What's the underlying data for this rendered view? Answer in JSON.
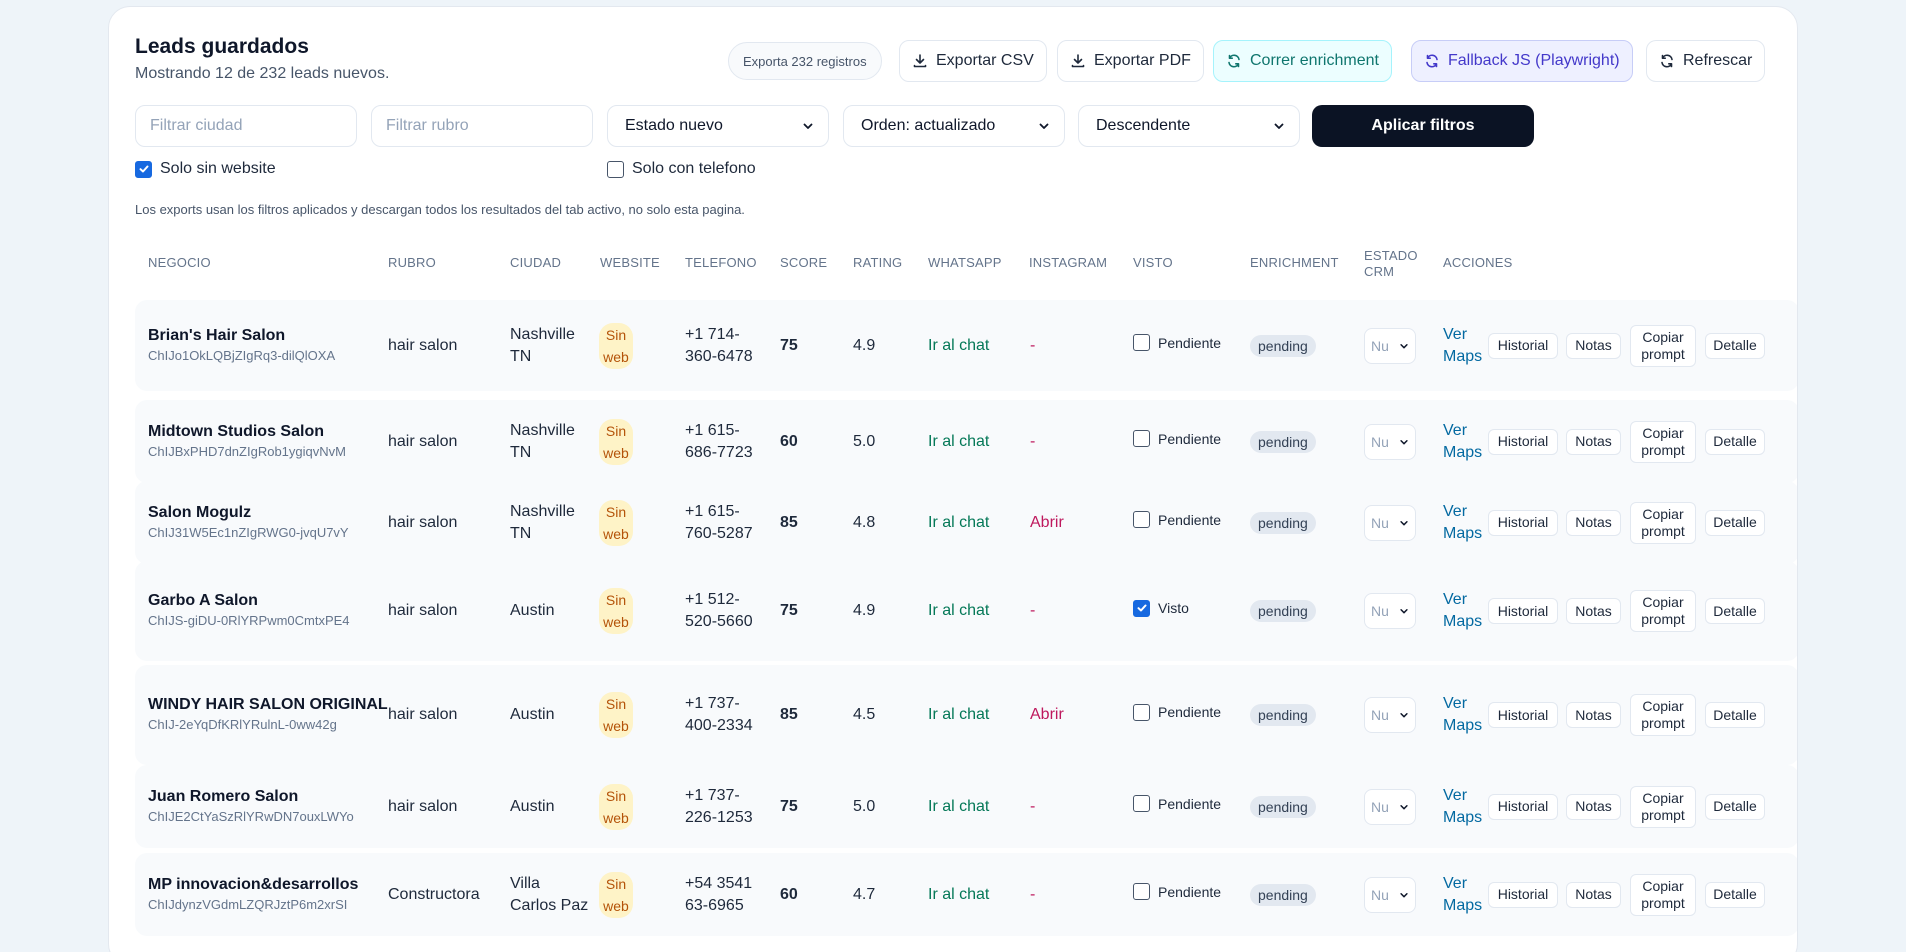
{
  "header": {
    "title": "Leads guardados",
    "subtitle": "Mostrando 12 de 232 leads nuevos."
  },
  "toolbar": {
    "export_count": "Exporta 232 registros",
    "export_csv": "Exportar CSV",
    "export_pdf": "Exportar PDF",
    "run_enrichment": "Correr enrichment",
    "fallback_js": "Fallback JS (Playwright)",
    "refresh": "Refrescar"
  },
  "filters": {
    "city_placeholder": "Filtrar ciudad",
    "category_placeholder": "Filtrar rubro",
    "state_value": "Estado nuevo",
    "order_value": "Orden: actualizado",
    "direction_value": "Descendente",
    "apply_label": "Aplicar filtros",
    "only_no_website_label": "Solo sin website",
    "only_no_website_checked": true,
    "only_with_phone_label": "Solo con telefono",
    "only_with_phone_checked": false,
    "note": "Los exports usan los filtros aplicados y descargan todos los resultados del tab activo, no solo esta pagina."
  },
  "table": {
    "columns": {
      "negocio": "NEGOCIO",
      "rubro": "RUBRO",
      "ciudad": "CIUDAD",
      "website": "WEBSITE",
      "telefono": "TELEFONO",
      "score": "SCORE",
      "rating": "RATING",
      "whatsapp": "WHATSAPP",
      "instagram": "INSTAGRAM",
      "visto": "VISTO",
      "enrichment": "ENRICHMENT",
      "estado_crm": "ESTADO CRM",
      "acciones": "ACCIONES"
    },
    "action_labels": {
      "maps": "Ver Maps",
      "historial": "Historial",
      "notas": "Notas",
      "copiar": "Copiar prompt",
      "detalle": "Detalle"
    },
    "rows": [
      {
        "name": "Brian's Hair Salon",
        "id": "ChIJo1OkLQBjZIgRq3-dilQlOXA",
        "rubro": "hair salon",
        "city": "Nashville TN",
        "website": "Sin web",
        "phone": "+1 714-360-6478",
        "score": "75",
        "rating": "4.9",
        "whatsapp": "Ir al chat",
        "instagram": "-",
        "visto": "Pendiente",
        "visto_checked": false,
        "enrichment": "pending",
        "crm": "Nu"
      },
      {
        "name": "Midtown Studios Salon",
        "id": "ChIJBxPHD7dnZIgRob1ygiqvNvM",
        "rubro": "hair salon",
        "city": "Nashville TN",
        "website": "Sin web",
        "phone": "+1 615-686-7723",
        "score": "60",
        "rating": "5.0",
        "whatsapp": "Ir al chat",
        "instagram": "-",
        "visto": "Pendiente",
        "visto_checked": false,
        "enrichment": "pending",
        "crm": "Nu"
      },
      {
        "name": "Salon Mogulz",
        "id": "ChIJ31W5Ec1nZIgRWG0-jvqU7vY",
        "rubro": "hair salon",
        "city": "Nashville TN",
        "website": "Sin web",
        "phone": "+1 615-760-5287",
        "score": "85",
        "rating": "4.8",
        "whatsapp": "Ir al chat",
        "instagram": "Abrir",
        "visto": "Pendiente",
        "visto_checked": false,
        "enrichment": "pending",
        "crm": "Nu"
      },
      {
        "name": "Garbo A Salon",
        "id": "ChIJS-giDU-0RlYRPwm0CmtxPE4",
        "rubro": "hair salon",
        "city": "Austin",
        "website": "Sin web",
        "phone": "+1 512-520-5660",
        "score": "75",
        "rating": "4.9",
        "whatsapp": "Ir al chat",
        "instagram": "-",
        "visto": "Visto",
        "visto_checked": true,
        "enrichment": "pending",
        "crm": "Nu"
      },
      {
        "name": "WINDY HAIR SALON ORIGINAL",
        "id": "ChIJ-2eYqDfKRlYRulnL-0ww42g",
        "rubro": "hair salon",
        "city": "Austin",
        "website": "Sin web",
        "phone": "+1 737-400-2334",
        "score": "85",
        "rating": "4.5",
        "whatsapp": "Ir al chat",
        "instagram": "Abrir",
        "visto": "Pendiente",
        "visto_checked": false,
        "enrichment": "pending",
        "crm": "Nu"
      },
      {
        "name": "Juan Romero Salon",
        "id": "ChIJE2CtYaSzRlYRwDN7ouxLWYo",
        "rubro": "hair salon",
        "city": "Austin",
        "website": "Sin web",
        "phone": "+1 737-226-1253",
        "score": "75",
        "rating": "5.0",
        "whatsapp": "Ir al chat",
        "instagram": "-",
        "visto": "Pendiente",
        "visto_checked": false,
        "enrichment": "pending",
        "crm": "Nu"
      },
      {
        "name": "MP innovacion&desarrollos",
        "id": "ChIJdynzVGdmLZQRJztP6m2xrSI",
        "rubro": "Constructora",
        "city": "Villa Carlos Paz",
        "website": "Sin web",
        "phone": "+54 3541 63-6965",
        "score": "60",
        "rating": "4.7",
        "whatsapp": "Ir al chat",
        "instagram": "-",
        "visto": "Pendiente",
        "visto_checked": false,
        "enrichment": "pending",
        "crm": "Nu"
      }
    ]
  }
}
